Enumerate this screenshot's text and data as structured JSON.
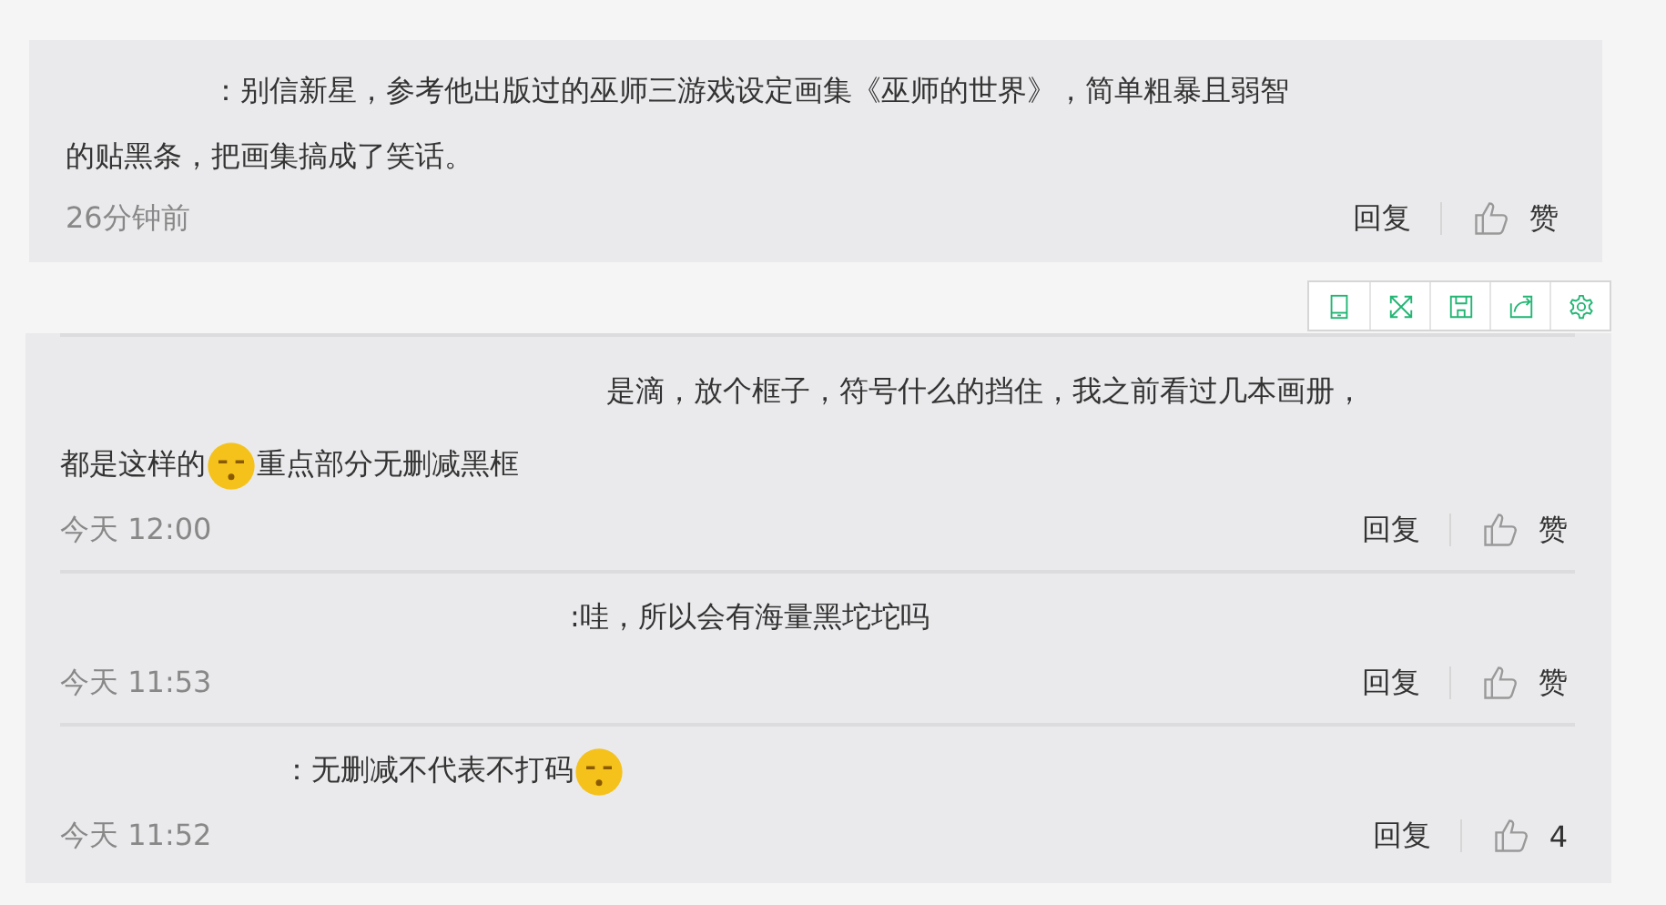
{
  "top_comment": {
    "segments": [
      {
        "kind": "text",
        "text": "：别信新星，参考他出版过的巫师三游戏设定画集《巫师的世界》，简单粗暴且弱智的贴黑条，把画集搞成了笑话。"
      }
    ],
    "time": "26分钟前",
    "reply": "回复",
    "like": "赞"
  },
  "toolbar": {
    "buttons": [
      {
        "kind": "tablet"
      },
      {
        "kind": "expand"
      },
      {
        "kind": "save"
      },
      {
        "kind": "share"
      },
      {
        "kind": "settings"
      }
    ]
  },
  "replies": [
    {
      "segments": [
        {
          "kind": "text",
          "text": "是滴，放个框子，符号什么的挡住，我之前看过几本画册，都是这样的"
        },
        {
          "kind": "emoji"
        },
        {
          "kind": "text",
          "text": "重点部分无删减黑框"
        }
      ],
      "time": "今天 12:00",
      "reply": "回复",
      "like": "赞"
    },
    {
      "segments": [
        {
          "kind": "text",
          "text": ":哇，所以会有海量黑坨坨吗"
        }
      ],
      "time": "今天 11:53",
      "reply": "回复",
      "like": "赞"
    },
    {
      "segments": [
        {
          "kind": "text",
          "text": "：无删减不代表不打码"
        },
        {
          "kind": "emoji"
        }
      ],
      "time": "今天 11:52",
      "reply": "回复",
      "like": "4"
    }
  ]
}
